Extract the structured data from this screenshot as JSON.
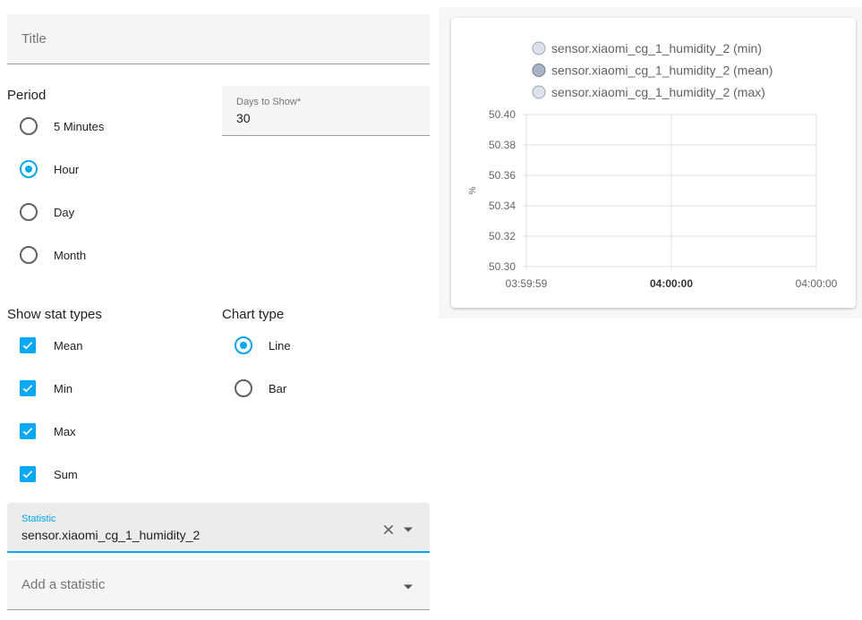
{
  "title_field": {
    "placeholder": "Title"
  },
  "period": {
    "heading": "Period",
    "options": [
      "5 Minutes",
      "Hour",
      "Day",
      "Month"
    ],
    "selected": "Hour"
  },
  "days_to_show": {
    "label": "Days to Show*",
    "value": "30"
  },
  "stat_types": {
    "heading": "Show stat types",
    "options": [
      {
        "label": "Mean",
        "checked": true
      },
      {
        "label": "Min",
        "checked": true
      },
      {
        "label": "Max",
        "checked": true
      },
      {
        "label": "Sum",
        "checked": true
      }
    ]
  },
  "chart_type": {
    "heading": "Chart type",
    "options": [
      "Line",
      "Bar"
    ],
    "selected": "Line"
  },
  "statistic_field": {
    "label": "Statistic",
    "value": "sensor.xiaomi_cg_1_humidity_2"
  },
  "add_statistic": {
    "placeholder": "Add a statistic"
  },
  "colors": {
    "accent": "#03a9f4",
    "legend_min": "#dce1ea",
    "legend_mean": "#a9b4c6",
    "legend_max": "#dce1ea"
  },
  "chart_data": {
    "type": "line",
    "series": [
      {
        "name": "sensor.xiaomi_cg_1_humidity_2 (min)",
        "values": []
      },
      {
        "name": "sensor.xiaomi_cg_1_humidity_2 (mean)",
        "values": []
      },
      {
        "name": "sensor.xiaomi_cg_1_humidity_2 (max)",
        "values": []
      }
    ],
    "x_ticks": [
      "03:59:59",
      "04:00:00",
      "04:00:00"
    ],
    "y_ticks": [
      "50.40",
      "50.38",
      "50.36",
      "50.34",
      "50.32",
      "50.30"
    ],
    "ylabel": "%",
    "ylim": [
      50.3,
      50.4
    ],
    "grid": true,
    "legend_position": "top"
  }
}
